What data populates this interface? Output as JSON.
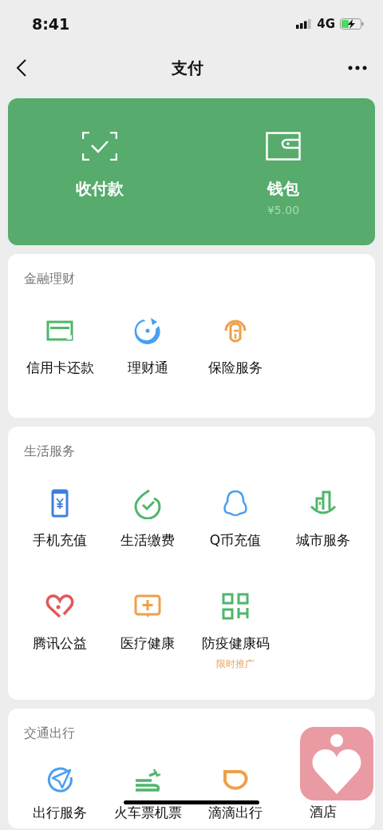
{
  "status_bar": {
    "time": "8:41",
    "network": "4G"
  },
  "nav": {
    "title": "支付"
  },
  "top_card": [
    {
      "label": "收付款"
    },
    {
      "label": "钱包",
      "sub": "¥5.00"
    }
  ],
  "sections": [
    {
      "title": "金融理财",
      "items": [
        {
          "label": "信用卡还款"
        },
        {
          "label": "理财通"
        },
        {
          "label": "保险服务"
        }
      ]
    },
    {
      "title": "生活服务",
      "items": [
        {
          "label": "手机充值"
        },
        {
          "label": "生活缴费"
        },
        {
          "label": "Q币充值"
        },
        {
          "label": "城市服务"
        },
        {
          "label": "腾讯公益"
        },
        {
          "label": "医疗健康"
        },
        {
          "label": "防疫健康码",
          "promo": "限时推广"
        }
      ]
    },
    {
      "title": "交通出行",
      "items": [
        {
          "label": "出行服务"
        },
        {
          "label": "火车票机票"
        },
        {
          "label": "滴滴出行"
        },
        {
          "label": "酒店"
        }
      ]
    }
  ]
}
